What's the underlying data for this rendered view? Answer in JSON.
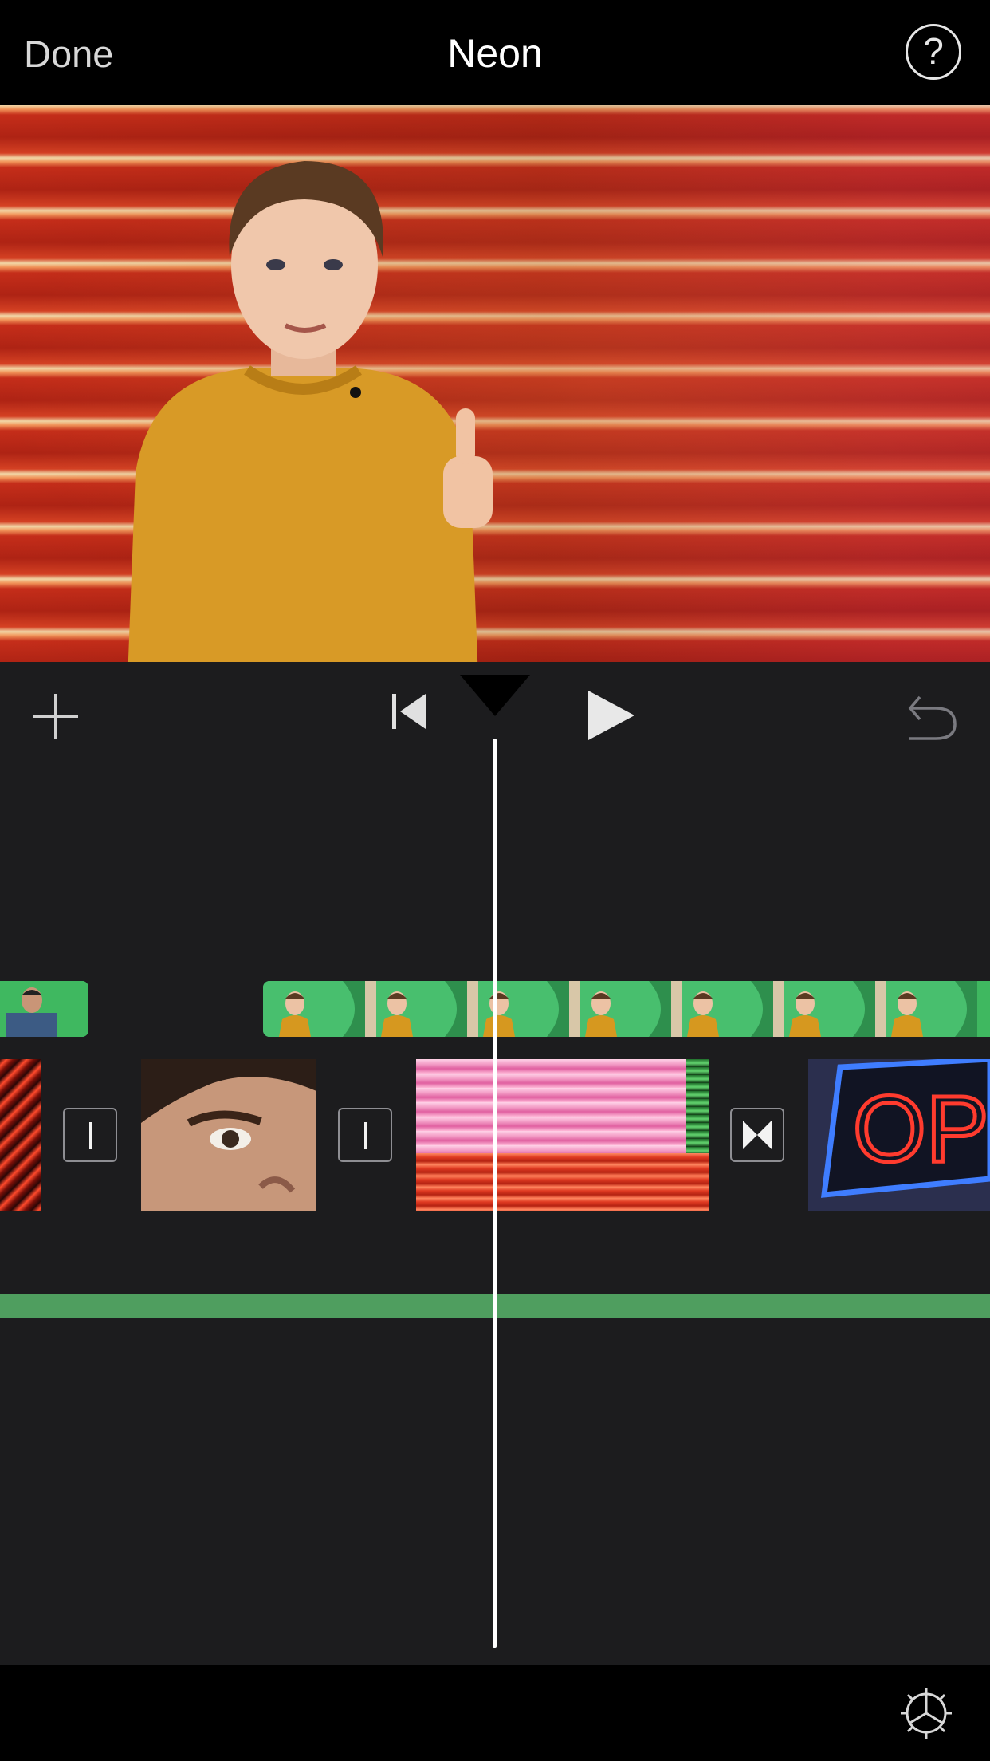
{
  "nav": {
    "done_label": "Done",
    "title": "Neon",
    "help_label": "?"
  },
  "preview": {
    "description_icon": "video-preview"
  },
  "controls": {
    "add_icon": "plus-icon",
    "skip_back_icon": "skip-to-start-icon",
    "play_icon": "play-icon",
    "undo_icon": "undo-icon"
  },
  "timeline": {
    "clip4_text": "OPE"
  },
  "colors": {
    "background": "#1c1c1e",
    "bar": "#000000",
    "audio_track": "#4f9e5f",
    "green_screen": "#3fb860"
  },
  "bottom": {
    "settings_icon": "gear-icon"
  }
}
